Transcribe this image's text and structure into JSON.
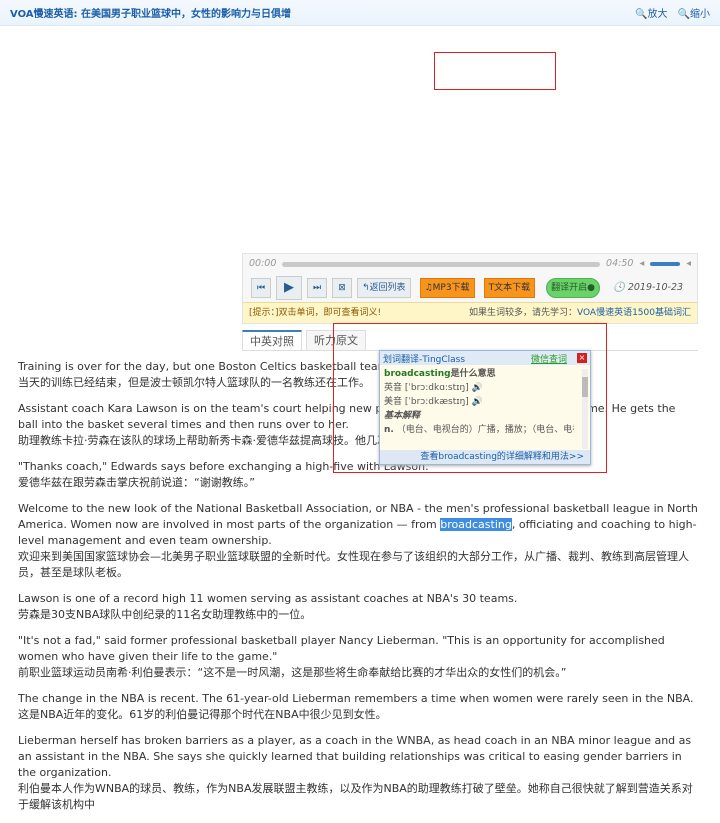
{
  "header": {
    "title": "VOA慢速英语: 在美国男子职业篮球中，女性的影响力与日俱增",
    "zoom_in": "放大",
    "zoom_out": "缩小"
  },
  "player": {
    "time_start": "00:00",
    "time_end": "04:50",
    "back": "返回列表",
    "mp3": "MP3下载",
    "text": "文本下载",
    "translate": "翻译开启",
    "date": "2019-10-23",
    "tip": "[提示：]双击单词，即可查看词义!",
    "tip_right": "如果生词较多，请先学习：",
    "tip_link": "VOA慢速英语1500基础词汇",
    "progress": 0
  },
  "tabs": [
    "中英对照",
    "听力原文"
  ],
  "paragraphs": [
    {
      "en": "Training is over for the day, but one Boston Celtics basketball team coach is still working.",
      "zh": "当天的训练已经结束，但是波士顿凯尔特人篮球队的一名教练还在工作。"
    },
    {
      "en": "Assistant coach Kara Lawson is on the team's court helping new player Carsen Edwards improve his game. He gets the ball into the basket several times and then runs over to her.",
      "zh": "助理教练卡拉·劳森在该队的球场上帮助新秀卡森·爱德华兹提高球技。他几次投篮命中，然后跑向了教练。"
    },
    {
      "en": "\"Thanks coach,\" Edwards says before exchanging a high-five with Lawson.",
      "zh": "爱德华兹在跟劳森击掌庆祝前说道：“谢谢教练。”"
    },
    {
      "en_a": "Welcome to the new look of the National Basketball Association, or NBA - the men's professional basketball league in North America. Women now are involved in most parts of the organization — from ",
      "en_sel": "broadcasting",
      "en_b": ", officiating and coaching to high-level management and even team ownership.",
      "zh": "欢迎来到美国国家篮球协会—北美男子职业篮球联盟的全新时代。女性现在参与了该组织的大部分工作，从广播、裁判、教练到高层管理人员，甚至是球队老板。"
    },
    {
      "en": "Lawson is one of a record high 11 women serving as assistant coaches at NBA's 30 teams.",
      "zh": "劳森是30支NBA球队中创纪录的11名女助理教练中的一位。"
    },
    {
      "en": "\"It's not a fad,\" said former professional basketball player Nancy Lieberman. \"This is an opportunity for accomplished women who have given their life to the game.\"",
      "zh": "前职业篮球运动员南希·利伯曼表示：“这不是一时风潮，这是那些将生命奉献给比赛的才华出众的女性们的机会。”"
    },
    {
      "en": "The change in the NBA is recent. The 61-year-old Lieberman remembers a time when women were rarely seen in the NBA.",
      "zh": "这是NBA近年的变化。61岁的利伯曼记得那个时代在NBA中很少见到女性。"
    },
    {
      "en": "Lieberman herself has broken barriers as a player, as a coach in the WNBA, as head coach in an NBA minor league and as an assistant in the NBA. She says she quickly learned that building relationships was critical to easing gender barriers in the organization.",
      "zh": "利伯曼本人作为WNBA的球员、教练，作为NBA发展联盟主教练，以及作为NBA的助理教练打破了壁垒。她称自己很快就了解到营造关系对于缓解该机构中"
    }
  ],
  "popup": {
    "title": "划词翻译-TingClass",
    "wechat": "微信查词",
    "headword": "broadcasting",
    "headword_suffix": "是什么意思",
    "uk_label": "英音",
    "uk": "[ˈbrɔ:dkɑ:stɪŋ]",
    "us_label": "美音",
    "us": "[ˈbrɔ:dkæstɪŋ]",
    "basic": "基本解释",
    "def_pos": "n.",
    "def": "（电台、电视台的）广播，播放；（电台、电视",
    "footer": "查看broadcasting的详细解释和用法>>"
  }
}
